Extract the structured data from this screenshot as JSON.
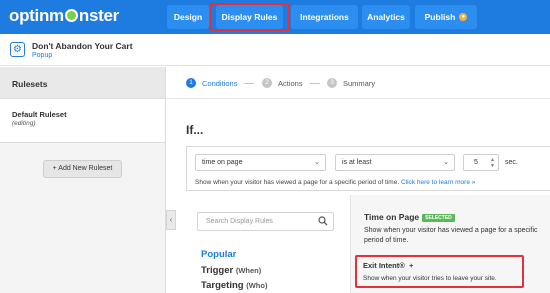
{
  "app": {
    "logo_text_left": "optinm",
    "logo_text_right": "nster"
  },
  "nav": {
    "design": "Design",
    "display_rules": "Display Rules",
    "integrations": "Integrations",
    "analytics": "Analytics",
    "publish": "Publish"
  },
  "campaign": {
    "title": "Don't Abandon Your Cart",
    "type": "Popup"
  },
  "sidebar": {
    "heading": "Rulesets",
    "ruleset_name": "Default Ruleset",
    "ruleset_status": "(editing)",
    "add_button": "+ Add New Ruleset"
  },
  "steps": [
    {
      "num": "1",
      "label": "Conditions"
    },
    {
      "num": "2",
      "label": "Actions"
    },
    {
      "num": "3",
      "label": "Summary"
    }
  ],
  "condition": {
    "if_label": "If...",
    "field": "time on page",
    "operator": "is at least",
    "value": "5",
    "unit": "sec.",
    "help_text": "Show when your visitor has viewed a page for a specific period of time.",
    "help_link": "Click here to learn more »"
  },
  "rules_panel": {
    "search_placeholder": "Search Display Rules",
    "categories": [
      {
        "label": "Popular",
        "sub": ""
      },
      {
        "label": "Trigger",
        "sub": "(When)"
      },
      {
        "label": "Targeting",
        "sub": "(Who)"
      }
    ]
  },
  "rule_detail": {
    "title": "Time on Page",
    "badge": "SELECTED",
    "description": "Show when your visitor has viewed a page for a specific period of time.",
    "exit_title": "Exit Intent®",
    "exit_plus": "+",
    "exit_description": "Show when your visitor tries to leave your site."
  },
  "colors": {
    "brand_blue": "#1e7be0",
    "highlight_red": "#e5303a",
    "badge_green": "#5cb85c"
  }
}
